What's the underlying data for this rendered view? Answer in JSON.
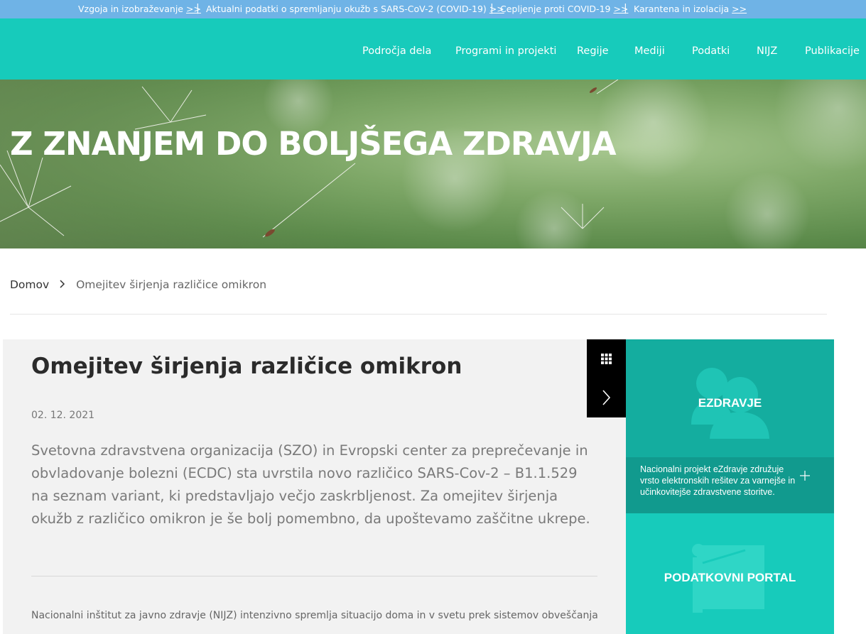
{
  "topbar": {
    "items": [
      {
        "label": "Vzgoja in izobraževanje",
        "arrow": ">>"
      },
      {
        "label": "Aktualni podatki o spremljanju okužb s SARS-CoV-2 (COVID-19)",
        "arrow": ">>"
      },
      {
        "label": "Cepljenje proti COVID-19",
        "arrow": ">>"
      },
      {
        "label": "Karantena in izolacija",
        "arrow": ">>"
      }
    ],
    "separator": "|"
  },
  "nav": {
    "items": [
      {
        "label": "Področja dela"
      },
      {
        "label": "Programi in projekti"
      },
      {
        "label": "Regije"
      },
      {
        "label": "Mediji"
      },
      {
        "label": "Podatki"
      },
      {
        "label": "NIJZ"
      },
      {
        "label": "Publikacije"
      }
    ]
  },
  "hero": {
    "title": "Z ZNANJEM DO BOLJŠEGA ZDRAVJA"
  },
  "breadcrumb": {
    "home": "Domov",
    "current": "Omejitev širjenja različice omikron"
  },
  "article": {
    "title": "Omejitev širjenja različice omikron",
    "date": "02. 12. 2021",
    "lead": "Svetovna zdravstvena organizacija (SZO) in Evropski center za preprečevanje in obvladovanje bolezni (ECDC) sta uvrstila novo različico SARS-Cov-2 – B1.1.529 na seznam variant, ki predstavljajo večjo zaskrbljenost. Za omejitev širjenja okužb z različico omikron je še bolj pomembno, da upoštevamo zaščitne ukrepe.",
    "body": "Nacionalni inštitut za javno zdravje (NIJZ) intenzivno spremlja situacijo doma in v svetu prek sistemov obveščanja med"
  },
  "sidebar": {
    "ezdravje": {
      "title": "EZDRAVJE",
      "description": "Nacionalni projekt eZdravje združuje vrsto elektronskih rešitev za varnejše in učinkovitejše zdravstvene storitve."
    },
    "portal": {
      "title": "PODATKOVNI PORTAL"
    }
  },
  "icons": {
    "grid": "grid-icon",
    "next": "chevron-right-icon",
    "breadcrumb_sep": "chevron-right-icon",
    "people": "people-icon",
    "presentation": "presentation-icon",
    "plus": "plus-icon"
  },
  "colors": {
    "topbar": "#6fb3e6",
    "navbar": "#17cbbb",
    "panel_ez": "#14ad9f",
    "panel_ez_desc": "#119a8e",
    "panel_portal": "#17cbbb"
  }
}
